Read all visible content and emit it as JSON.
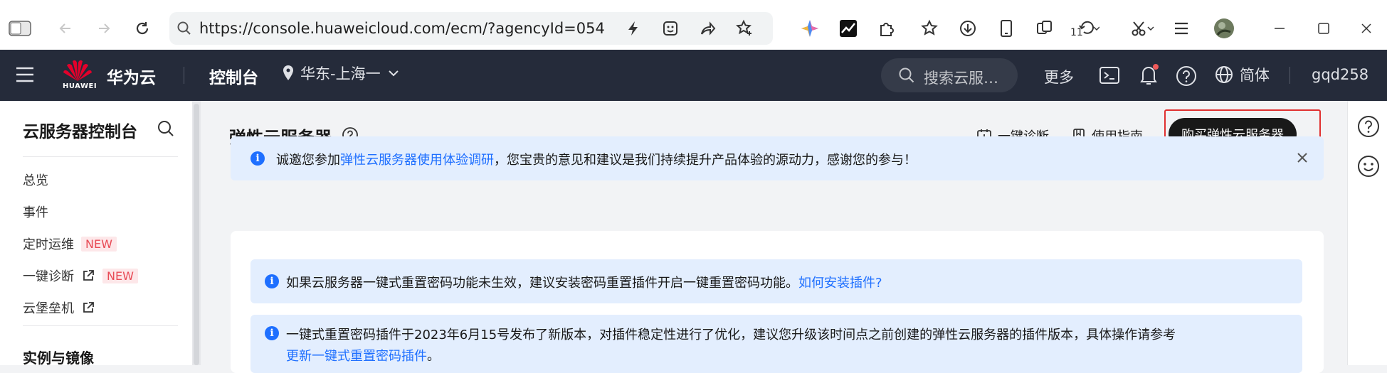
{
  "browser": {
    "url": "https://console.huaweicloud.com/ecm/?agencyId=054",
    "profile_badge": "11"
  },
  "topnav": {
    "brand_sub": "HUAWEI",
    "brand": "华为云",
    "console": "控制台",
    "region": "华东-上海一",
    "search_placeholder": "搜索云服…",
    "more": "更多",
    "language": "简体",
    "user": "gqd258"
  },
  "sidebar": {
    "title": "云服务器控制台",
    "items": [
      {
        "label": "总览"
      },
      {
        "label": "事件"
      },
      {
        "label": "定时运维",
        "badge": "NEW"
      },
      {
        "label": "一键诊断",
        "badge": "NEW"
      },
      {
        "label": "云堡垒机"
      }
    ],
    "section": "实例与镜像"
  },
  "main": {
    "title": "弹性云服务器",
    "diagnose": "一键诊断",
    "guide": "使用指南",
    "buy": "购买弹性云服务器",
    "survey": {
      "prefix": "诚邀您参加",
      "link": "弹性云服务器使用体验调研",
      "suffix": "，您宝贵的意见和建议是我们持续提升产品体验的源动力，感谢您的参与！"
    },
    "notice1": {
      "text": "如果云服务器一键式重置密码功能未生效，建议安装密码重置插件开启一键重置密码功能。",
      "link": "如何安装插件?"
    },
    "notice2": {
      "text": "一键式重置密码插件于2023年6月15号发布了新版本，对插件稳定性进行了优化，建议您升级该时间点之前创建的弹性云服务器的插件版本，具体操作请参考",
      "link": "更新一键式重置密码插件",
      "suffix": "。"
    }
  }
}
